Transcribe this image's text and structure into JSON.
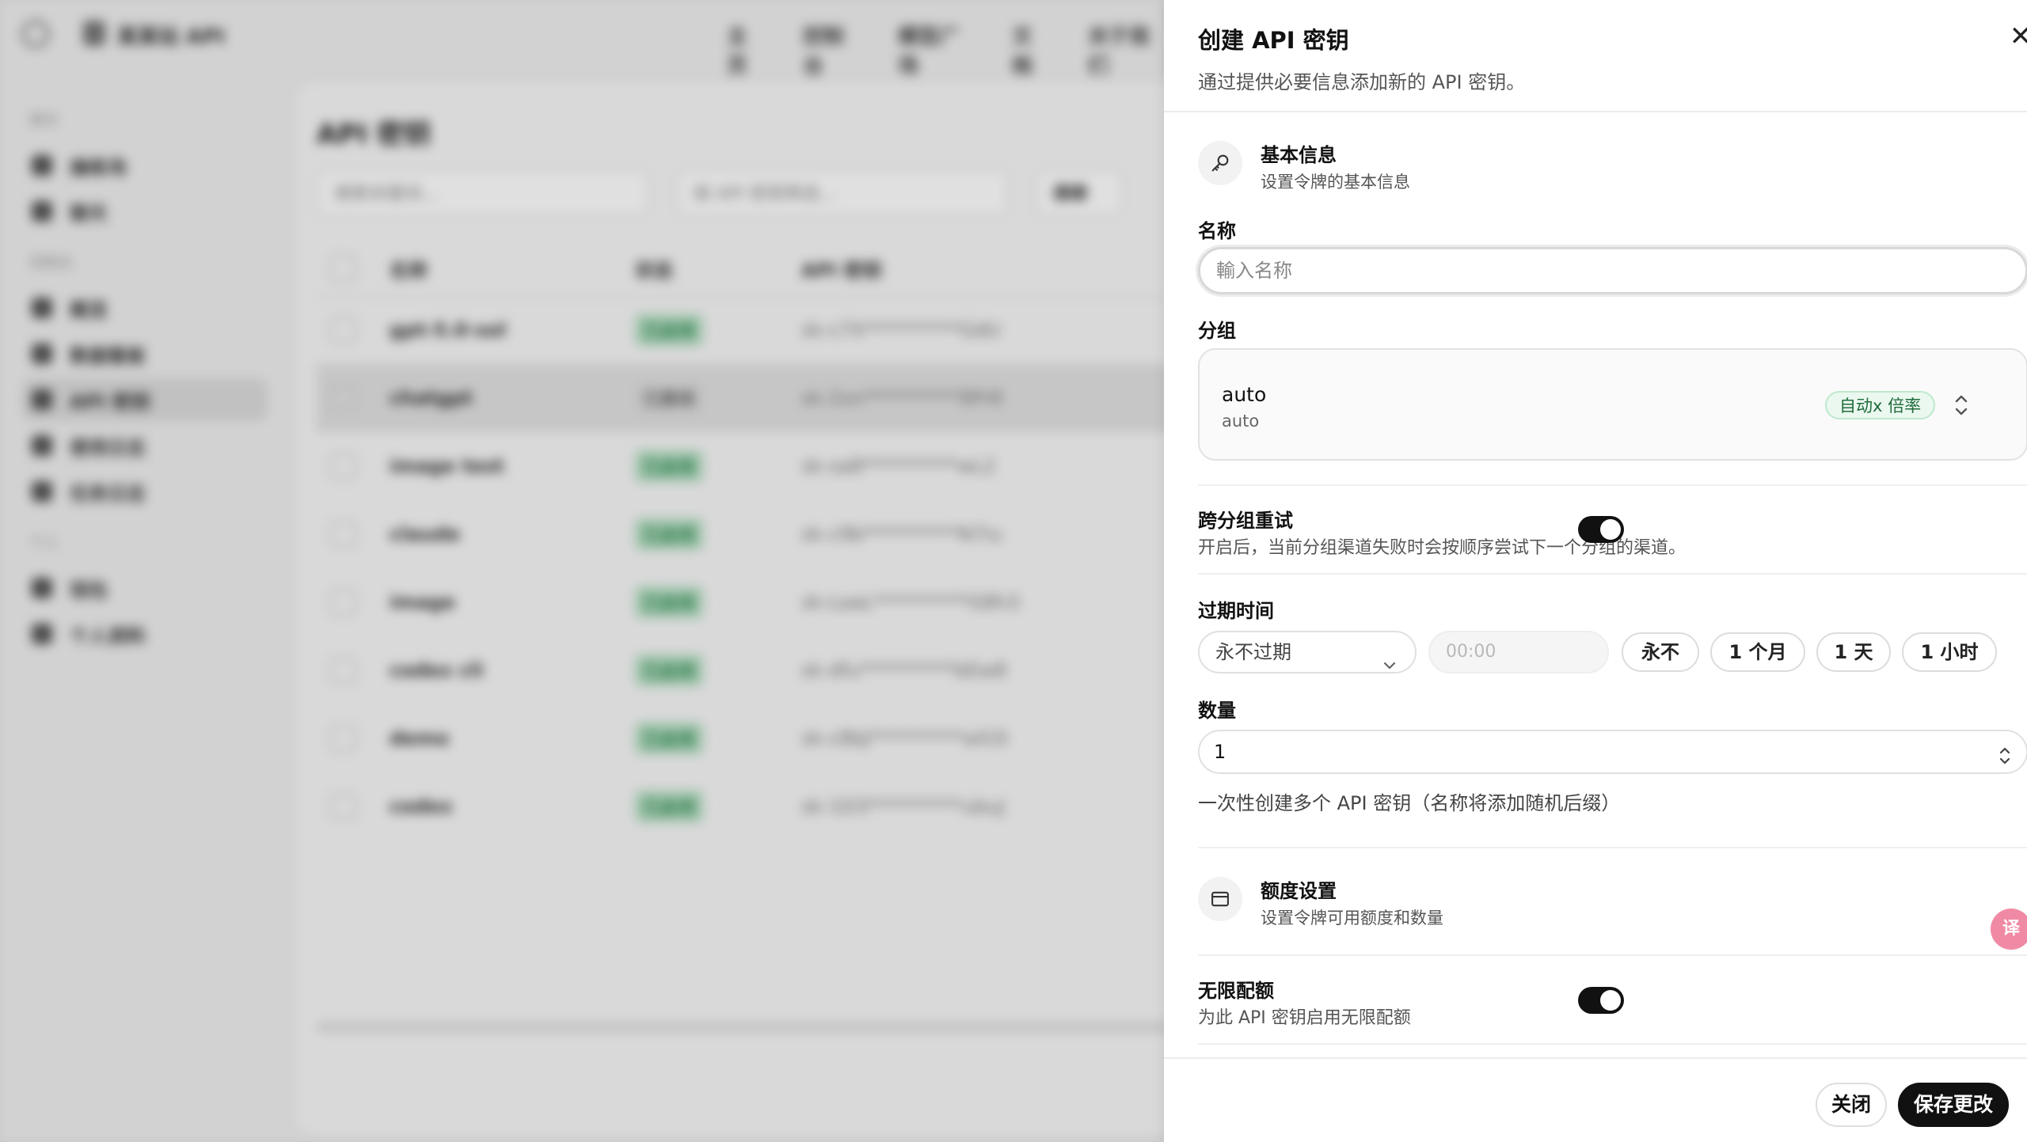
{
  "background": {
    "brand": "某某站 API",
    "nav": [
      "主页",
      "控制台",
      "模型广场",
      "文档",
      "关于我们"
    ],
    "sidebar": {
      "groups": [
        {
          "label": "聊天",
          "items": [
            "操练场",
            "聊天"
          ]
        },
        {
          "label": "控制台",
          "items": [
            "概览",
            "数据看板",
            "API 密钥",
            "使用日志",
            "任务日志"
          ]
        },
        {
          "label": "个人",
          "items": [
            "钱包",
            "个人资料"
          ]
        }
      ],
      "active": "API 密钥"
    },
    "page_title": "API 密钥",
    "filters": {
      "search_placeholder": "搜索关键词...",
      "key_placeholder": "按 API 密钥筛选...",
      "button": "搜索"
    },
    "table": {
      "columns": [
        "名称",
        "状态",
        "API 密钥"
      ],
      "rows": [
        {
          "name": "gpt-5.0-sol",
          "status": "已启用",
          "key": "sk-c7X**********GdU"
        },
        {
          "name": "chatgpt",
          "status": "已禁用",
          "key": "sk-2xn**********9Pr8"
        },
        {
          "name": "image test",
          "status": "已启用",
          "key": "sk-sa8**********wL2"
        },
        {
          "name": "claude",
          "status": "已启用",
          "key": "sk-c9b**********N7iu"
        },
        {
          "name": "image",
          "status": "已启用",
          "key": "sk-LaaL**********G8h3"
        },
        {
          "name": "codex cli",
          "status": "已启用",
          "key": "sk-dfu**********bEw8"
        },
        {
          "name": "demo",
          "status": "已启用",
          "key": "sk-c8bJ**********aX2t"
        },
        {
          "name": "codex",
          "status": "已启用",
          "key": "sk-1D3**********ubuJ"
        }
      ]
    }
  },
  "drawer": {
    "title": "创建 API 密钥",
    "subtitle": "通过提供必要信息添加新的 API 密钥。",
    "basic": {
      "title": "基本信息",
      "subtitle": "设置令牌的基本信息"
    },
    "name": {
      "label": "名称",
      "placeholder": "輸入名称",
      "value": ""
    },
    "group": {
      "label": "分组",
      "value": "auto",
      "sub": "auto",
      "badge": "自动x 倍率"
    },
    "cross_retry": {
      "label": "跨分组重试",
      "desc": "开启后，当前分组渠道失败时会按顺序尝试下一个分组的渠道。",
      "enabled": true
    },
    "expiry": {
      "label": "过期时间",
      "select_value": "永不过期",
      "time_placeholder": "00:00",
      "quick": [
        "永不",
        "1 个月",
        "1 天",
        "1 小时"
      ]
    },
    "quantity": {
      "label": "数量",
      "value": "1",
      "hint": "一次性创建多个 API 密钥（名称将添加随机后缀）"
    },
    "quota": {
      "title": "额度设置",
      "subtitle": "设置令牌可用额度和数量"
    },
    "unlimited": {
      "label": "无限配额",
      "desc": "为此 API 密钥启用无限配额",
      "enabled": true
    },
    "footer": {
      "close": "关闭",
      "save": "保存更改"
    },
    "fab_label": "译"
  }
}
